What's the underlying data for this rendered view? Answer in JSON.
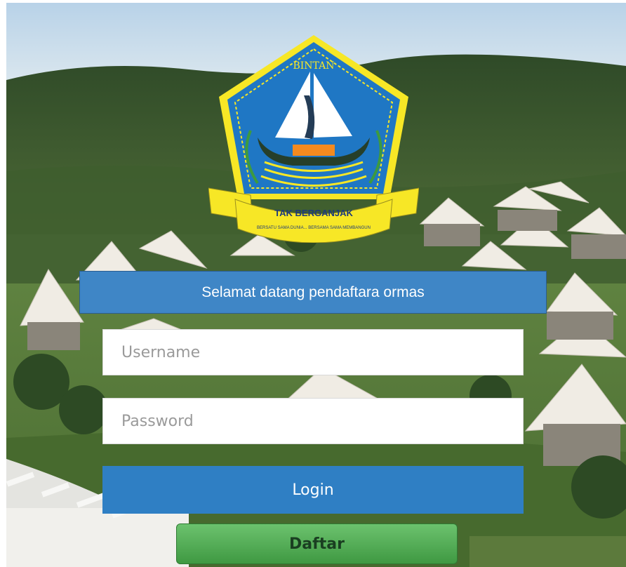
{
  "logo": {
    "top_text": "BINTAN",
    "ribbon_main": "TAK BERGANJAK",
    "ribbon_sub": "BERSATU SAMA DUNIA... BERSAMA SAMA MEMBANGUN"
  },
  "welcome": {
    "text": "Selamat datang pendaftara ormas"
  },
  "form": {
    "username_placeholder": "Username",
    "password_placeholder": "Password",
    "login_label": "Login",
    "register_label": "Daftar"
  },
  "colors": {
    "accent": "#2f7fc4",
    "banner": "#3f86c6",
    "register": "#4caf50",
    "logo_blue": "#1f77c4",
    "logo_yellow": "#f7e726"
  },
  "icons": [
    "regency-emblem-icon"
  ]
}
